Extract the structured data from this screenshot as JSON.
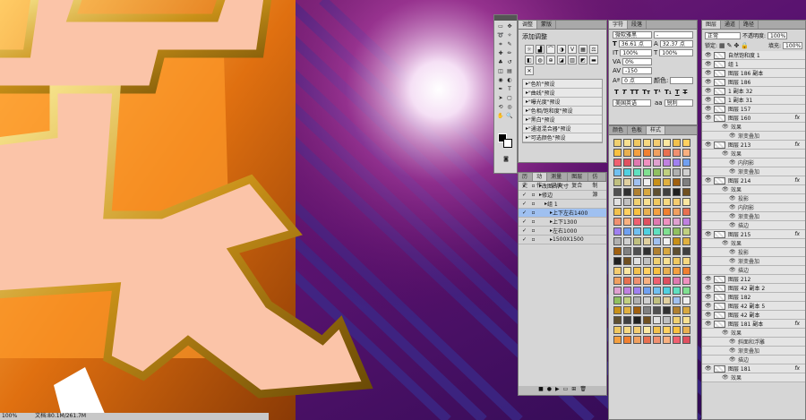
{
  "colors": {
    "accent": "#9fc0f0",
    "panel": "#d6d6d6",
    "panel_header": "#a9a9a9"
  },
  "adjust_panel": {
    "tabs": [
      "调整",
      "蒙版"
    ],
    "title": "添加调整",
    "presets": [
      "\"色阶\"预设",
      "\"曲线\"预设",
      "\"曝光度\"预设",
      "\"色相/饱和度\"预设",
      "\"黑白\"预设",
      "\"通道混合器\"预设",
      "\"可选颜色\"预设"
    ]
  },
  "char_panel": {
    "tabs": [
      "字符",
      "段落"
    ],
    "font_family": "微软雅黑",
    "font_style": "-",
    "font_size": "36.61 点",
    "leading": "32.37 点",
    "scale_v": "100%",
    "scale_h": "100%",
    "tracking": "0%",
    "kerning": "-150",
    "baseline": "0 点",
    "color_label": "颜色:",
    "language": "美国英语",
    "aa_icon": "aa",
    "aa_mode": "锐利"
  },
  "swatch_panel": {
    "tabs": [
      "颜色",
      "色板",
      "样式"
    ]
  },
  "actions_panel": {
    "tabs": [
      "历史",
      "动作",
      "测量记录",
      "图层复合",
      "仿制源"
    ],
    "items": [
      {
        "label": "改图片尺寸",
        "indent": 0,
        "selected": false
      },
      {
        "label": "修边",
        "indent": 0,
        "selected": false
      },
      {
        "label": "组 1",
        "indent": 1,
        "selected": false
      },
      {
        "label": "上下左右1400",
        "indent": 2,
        "selected": true
      },
      {
        "label": "上下1300",
        "indent": 2,
        "selected": false
      },
      {
        "label": "左右1000",
        "indent": 2,
        "selected": false
      },
      {
        "label": "1500X1500",
        "indent": 2,
        "selected": false
      }
    ]
  },
  "layers_panel": {
    "tabs": [
      "图层",
      "通道",
      "路径"
    ],
    "blend_mode": "正常",
    "opacity_label": "不透明度:",
    "opacity": "100%",
    "lock_label": "锁定:",
    "fill_label": "填充:",
    "fill": "100%",
    "rows": [
      {
        "label": "自然饱和度 1",
        "kind": "layer",
        "fx": false,
        "selected": false
      },
      {
        "label": "组 1",
        "kind": "layer",
        "fx": false,
        "selected": false
      },
      {
        "label": "图层 186 副本",
        "kind": "layer",
        "fx": false,
        "selected": false
      },
      {
        "label": "图层 186",
        "kind": "layer",
        "fx": false,
        "selected": false
      },
      {
        "label": "1 副本 32",
        "kind": "layer",
        "fx": false,
        "selected": false
      },
      {
        "label": "1 副本 31",
        "kind": "layer",
        "fx": false,
        "selected": false
      },
      {
        "label": "图层 157",
        "kind": "layer",
        "fx": false,
        "selected": false
      },
      {
        "label": "图层 160",
        "kind": "layer",
        "fx": true,
        "selected": false
      },
      {
        "label": "效果",
        "kind": "sub",
        "fx": false,
        "selected": false
      },
      {
        "label": "渐变叠加",
        "kind": "sub2",
        "fx": false,
        "selected": false
      },
      {
        "label": "图层 213",
        "kind": "layer",
        "fx": true,
        "selected": false
      },
      {
        "label": "效果",
        "kind": "sub",
        "fx": false,
        "selected": false
      },
      {
        "label": "内阴影",
        "kind": "sub2",
        "fx": false,
        "selected": false
      },
      {
        "label": "渐变叠加",
        "kind": "sub2",
        "fx": false,
        "selected": false
      },
      {
        "label": "图层 214",
        "kind": "layer",
        "fx": true,
        "selected": false
      },
      {
        "label": "效果",
        "kind": "sub",
        "fx": false,
        "selected": false
      },
      {
        "label": "投影",
        "kind": "sub2",
        "fx": false,
        "selected": false
      },
      {
        "label": "内阴影",
        "kind": "sub2",
        "fx": false,
        "selected": false
      },
      {
        "label": "渐变叠加",
        "kind": "sub2",
        "fx": false,
        "selected": false
      },
      {
        "label": "描边",
        "kind": "sub2",
        "fx": false,
        "selected": false
      },
      {
        "label": "图层 215",
        "kind": "layer",
        "fx": true,
        "selected": false
      },
      {
        "label": "效果",
        "kind": "sub",
        "fx": false,
        "selected": false
      },
      {
        "label": "投影",
        "kind": "sub2",
        "fx": false,
        "selected": false
      },
      {
        "label": "渐变叠加",
        "kind": "sub2",
        "fx": false,
        "selected": false
      },
      {
        "label": "描边",
        "kind": "sub2",
        "fx": false,
        "selected": false
      },
      {
        "label": "图层 212",
        "kind": "layer",
        "fx": false,
        "selected": false
      },
      {
        "label": "图层 42 副本 2",
        "kind": "layer",
        "fx": false,
        "selected": false
      },
      {
        "label": "图层 182",
        "kind": "layer",
        "fx": false,
        "selected": false
      },
      {
        "label": "图层 42 副本 5",
        "kind": "layer",
        "fx": false,
        "selected": false
      },
      {
        "label": "图层 42 副本",
        "kind": "layer",
        "fx": false,
        "selected": false
      },
      {
        "label": "图层 181 副本",
        "kind": "layer",
        "fx": true,
        "selected": false
      },
      {
        "label": "效果",
        "kind": "sub",
        "fx": false,
        "selected": false
      },
      {
        "label": "斜面和浮雕",
        "kind": "sub2",
        "fx": false,
        "selected": false
      },
      {
        "label": "渐变叠加",
        "kind": "sub2",
        "fx": false,
        "selected": false
      },
      {
        "label": "描边",
        "kind": "sub2",
        "fx": false,
        "selected": false
      },
      {
        "label": "图层 181",
        "kind": "layer",
        "fx": true,
        "selected": false
      },
      {
        "label": "效果",
        "kind": "sub",
        "fx": false,
        "selected": false
      }
    ]
  },
  "status": {
    "zoom": "100%",
    "doc": "文档:80.1M/261.7M"
  }
}
